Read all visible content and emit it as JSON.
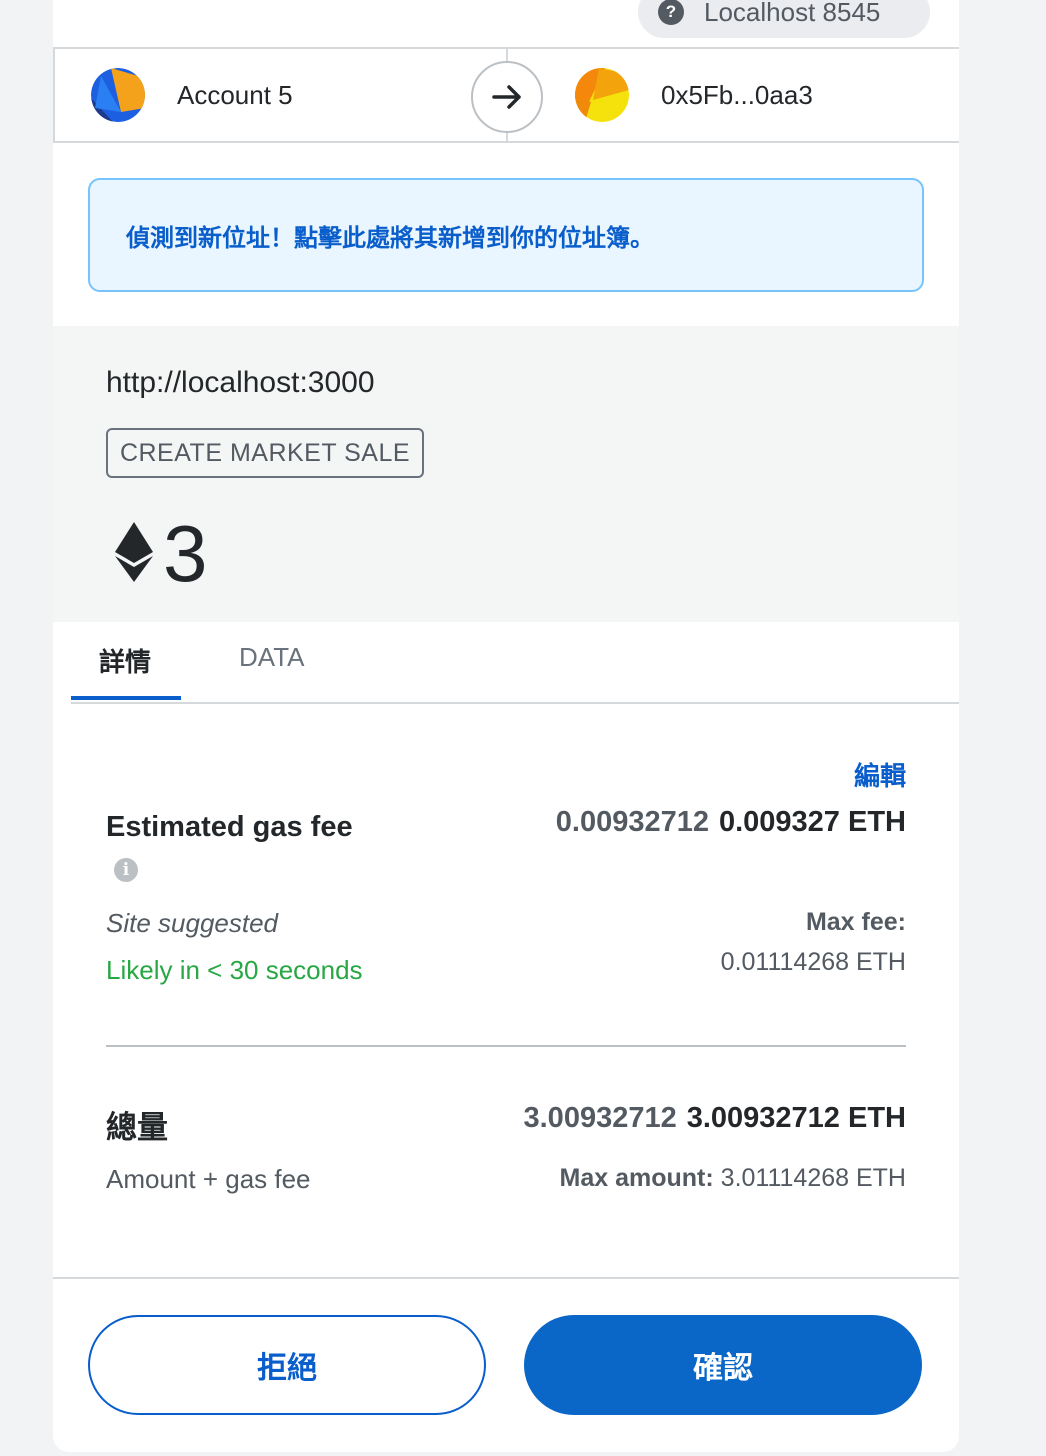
{
  "network": {
    "label": "Localhost 8545"
  },
  "sender": {
    "name": "Account 5"
  },
  "recipient": {
    "address": "0x5Fb...0aa3"
  },
  "banner": {
    "text": "偵測到新位址！點擊此處將其新增到你的位址簿。"
  },
  "site": {
    "origin": "http://localhost:3000",
    "method": "CREATE MARKET SALE",
    "amount": "3"
  },
  "tabs": {
    "details": "詳情",
    "data": "DATA"
  },
  "gas": {
    "edit_label": "編輯",
    "title": "Estimated gas fee",
    "value_primary": "0.00932712",
    "value_secondary": "0.009327 ETH",
    "source": "Site suggested",
    "timing": "Likely in < 30 seconds",
    "max_fee_label": "Max fee:",
    "max_fee_value": "0.01114268 ETH"
  },
  "total": {
    "label": "總量",
    "value_primary": "3.00932712",
    "value_secondary": "3.00932712 ETH",
    "sublabel": "Amount + gas fee",
    "max_amount_label": "Max amount:",
    "max_amount_value": "3.01114268 ETH"
  },
  "buttons": {
    "reject": "拒絕",
    "confirm": "確認"
  },
  "colors": {
    "accent": "#0a5ecb",
    "success": "#28a745",
    "banner_bg": "#eaf6ff"
  }
}
